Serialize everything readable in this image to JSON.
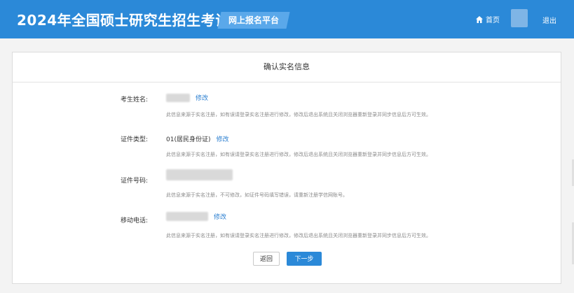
{
  "header": {
    "app_title": "2024年全国硕士研究生招生考试",
    "platform_badge": "网上报名平台",
    "home_label": "首页",
    "logout_label": "退出"
  },
  "card": {
    "title": "确认实名信息",
    "fields": [
      {
        "label": "考生姓名:",
        "value": "",
        "edit_label": "修改",
        "note": "此信息来源于实名注册，如有误请登录实名注册进行修改，修改后退出系统且关闭浏览器重新登录并同步信息后方可生效。"
      },
      {
        "label": "证件类型:",
        "value": "01(居民身份证)",
        "edit_label": "修改",
        "note": "此信息来源于实名注册，如有误请登录实名注册进行修改，修改后退出系统且关闭浏览器重新登录并同步信息后方可生效。"
      },
      {
        "label": "证件号码:",
        "value": "",
        "note": "此信息来源于实名注册，不可修改，如证件号码填写错误，请重新注册学信网账号。"
      },
      {
        "label": "移动电话:",
        "value": "",
        "edit_label": "修改",
        "note": "此信息来源于实名注册，如有误请登录实名注册进行修改，修改后退出系统且关闭浏览器重新登录并同步信息后方可生效。"
      }
    ],
    "back_button": "返回",
    "next_button": "下一步"
  },
  "colors": {
    "header_bg": "#2b89d8",
    "badge_bg": "#5aa8ea",
    "link": "#2b7fd0",
    "primary_button": "#2b89d8"
  }
}
